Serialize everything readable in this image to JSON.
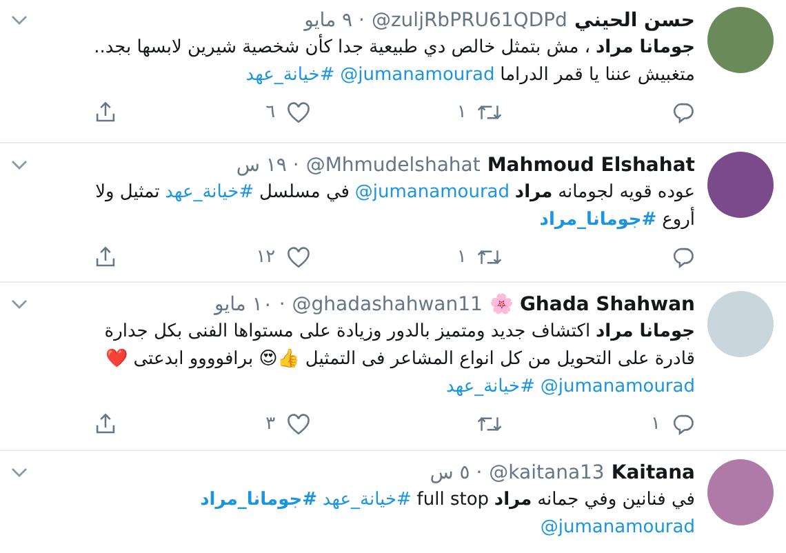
{
  "tweets": [
    {
      "name": "حسن الحيني",
      "handle": "@zuljRbPRU61QDPd",
      "time": "· ٩ مايو",
      "lines": [
        [
          {
            "kind": "bold",
            "text": "جومانا مراد"
          },
          {
            "kind": "text",
            "text": "، مش بتمثل خالص دي طبيعية جدا كأن شخصية شيرين لابسها بجد.."
          }
        ],
        [
          {
            "kind": "text",
            "text": "متغبيش عننا يا قمر الدراما"
          },
          {
            "kind": "mention",
            "text": "@jumanamourad"
          },
          {
            "kind": "hashtag",
            "text": "#خيانة_عهد"
          }
        ]
      ],
      "retweets": "١",
      "likes": "٦"
    },
    {
      "name": "Mahmoud Elshahat",
      "handle": "@Mhmudelshahat",
      "time": "· ١٩ س",
      "lines": [
        [
          {
            "kind": "text",
            "text": "عوده قويه لجومانه"
          },
          {
            "kind": "bold",
            "text": "مراد"
          },
          {
            "kind": "mention",
            "text": "@jumanamourad"
          },
          {
            "kind": "text",
            "text": "في مسلسل"
          },
          {
            "kind": "hashtag",
            "text": "#خيانة_عهد"
          },
          {
            "kind": "text",
            "text": "تمثيل ولا"
          }
        ],
        [
          {
            "kind": "text",
            "text": "أروع"
          },
          {
            "kind": "bold_hashtag",
            "text": "#جومانا_مراد"
          }
        ]
      ],
      "retweets": "١",
      "likes": "١٢"
    },
    {
      "name": "Ghada Shahwan",
      "name_emoji": "🌸",
      "handle": "@ghadashahwan11",
      "time": "· ١٠ مايو",
      "lines": [
        [
          {
            "kind": "bold",
            "text": "جومانا مراد"
          },
          {
            "kind": "text",
            "text": "اكتشاف جديد ومتميز بالدور وزيادة على مستواها الفنى بكل جدارة"
          }
        ],
        [
          {
            "kind": "text",
            "text": "قادرة على التحويل من كل انواع المشاعر فى التمثيل 👍😍 برافوووو ابدعتى ❤️"
          }
        ],
        [
          {
            "kind": "mention",
            "text": "@jumanamourad"
          },
          {
            "kind": "hashtag",
            "text": "#خيانة_عهد"
          }
        ]
      ],
      "replies": "١",
      "likes": "٣"
    },
    {
      "name": "Kaitana",
      "handle": "@kaitana13",
      "time": "· ٥ س",
      "lines": [
        [
          {
            "kind": "text",
            "text": "في فنانين وفي جمانه"
          },
          {
            "kind": "bold",
            "text": "مراد"
          },
          {
            "kind": "text",
            "text": "full stop"
          },
          {
            "kind": "hashtag",
            "text": "#خيانة_عهد"
          },
          {
            "kind": "bold_hashtag",
            "text": "#جومانا_مراد"
          }
        ],
        [
          {
            "kind": "mention",
            "text": "@jumanamourad"
          }
        ]
      ]
    }
  ]
}
